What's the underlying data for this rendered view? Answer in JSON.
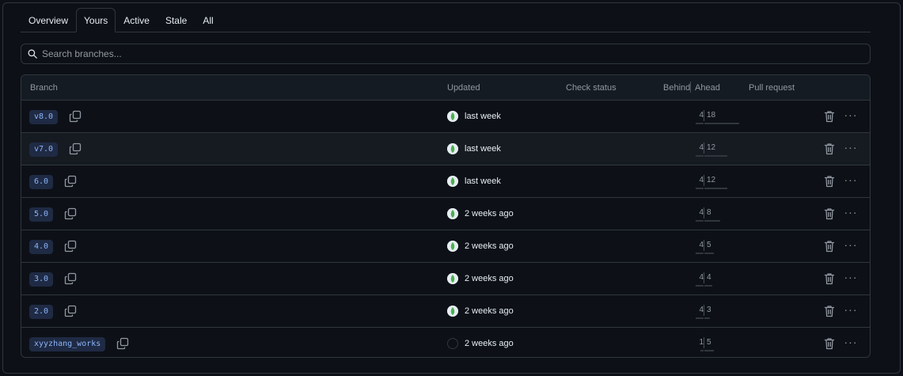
{
  "tabs": [
    {
      "label": "Overview",
      "selected": false
    },
    {
      "label": "Yours",
      "selected": true
    },
    {
      "label": "Active",
      "selected": false
    },
    {
      "label": "Stale",
      "selected": false
    },
    {
      "label": "All",
      "selected": false
    }
  ],
  "search": {
    "placeholder": "Search branches...",
    "value": ""
  },
  "table": {
    "headers": {
      "branch": "Branch",
      "updated": "Updated",
      "check_status": "Check status",
      "behind": "Behind",
      "ahead": "Ahead",
      "pull_request": "Pull request"
    },
    "rows": [
      {
        "branch": "v8.0",
        "updated": "last week",
        "behind": "4",
        "ahead": "18",
        "avatar": "leaf-avatar"
      },
      {
        "branch": "v7.0",
        "updated": "last week",
        "behind": "4",
        "ahead": "12",
        "avatar": "leaf-avatar"
      },
      {
        "branch": "6.0",
        "updated": "last week",
        "behind": "4",
        "ahead": "12",
        "avatar": "leaf-avatar"
      },
      {
        "branch": "5.0",
        "updated": "2 weeks ago",
        "behind": "4",
        "ahead": "8",
        "avatar": "leaf-avatar"
      },
      {
        "branch": "4.0",
        "updated": "2 weeks ago",
        "behind": "4",
        "ahead": "5",
        "avatar": "leaf-avatar"
      },
      {
        "branch": "3.0",
        "updated": "2 weeks ago",
        "behind": "4",
        "ahead": "4",
        "avatar": "leaf-avatar"
      },
      {
        "branch": "2.0",
        "updated": "2 weeks ago",
        "behind": "4",
        "ahead": "3",
        "avatar": "leaf-avatar"
      },
      {
        "branch": "xyyzhang_works",
        "updated": "2 weeks ago",
        "behind": "1",
        "ahead": "5",
        "avatar": "empty-avatar"
      }
    ]
  },
  "icons": {
    "search": "search-icon",
    "copy": "copy-icon",
    "delete": "trash-icon",
    "more": "kebab-horizontal-icon"
  },
  "colors": {
    "background": "#0d1117",
    "border": "#30363d",
    "branch_tag_bg": "#1f2a44",
    "branch_tag_text": "#8ab4f8",
    "avatar_green": "#4caf50"
  }
}
